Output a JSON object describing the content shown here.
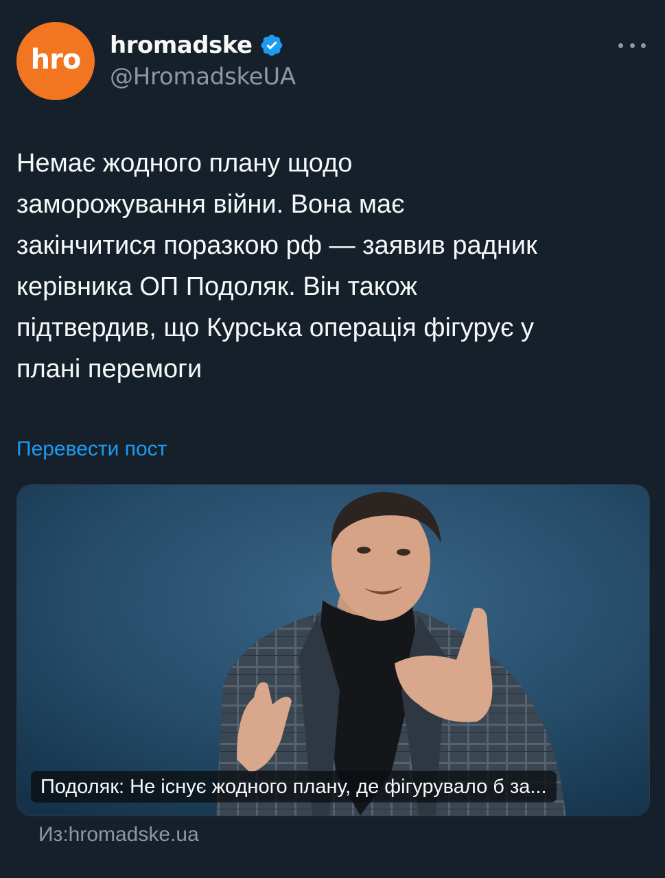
{
  "tweet": {
    "avatar_text": "hro",
    "display_name": "hromadske",
    "handle": "@HromadskeUA",
    "verified_icon": "verified-badge-icon",
    "more_icon": "more-options-icon",
    "text": "Немає жодного плану щодо\nзаморожування війни. Вона має\nзакінчитися поразкою рф — заявив радник\nкерівника ОП Подоляк. Він також\nпідтвердив, що Курська операція фігурує у\nплані перемоги",
    "translate_label": "Перевести пост"
  },
  "card": {
    "title": "Подоляк: Не існує жодного плану, де фігурувало б за...",
    "source": "Из:hromadske.ua"
  },
  "colors": {
    "background": "#15202b",
    "avatar": "#f27621",
    "link": "#1d9bf0",
    "verified": "#1d9bf0",
    "secondary_text": "#8b98a5"
  }
}
